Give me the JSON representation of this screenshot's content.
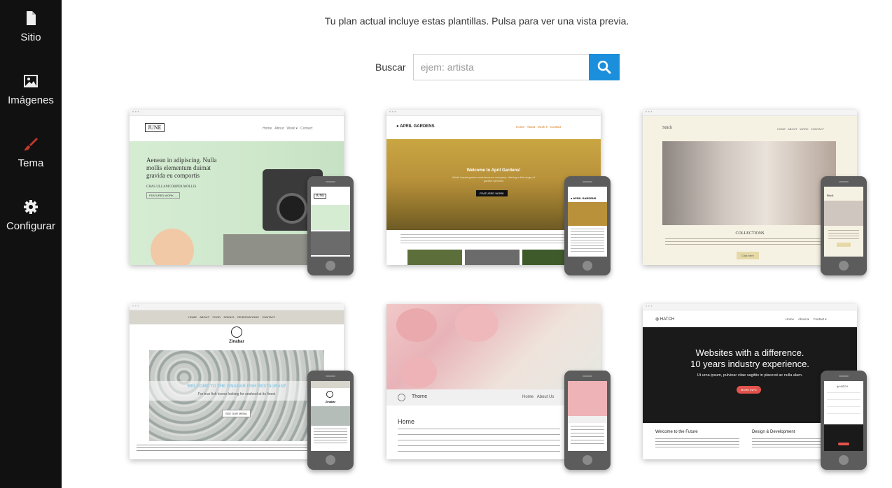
{
  "sidebar": {
    "items": [
      {
        "label": "Sitio",
        "icon": "file-icon"
      },
      {
        "label": "Imágenes",
        "icon": "image-icon"
      },
      {
        "label": "Tema",
        "icon": "brush-icon"
      },
      {
        "label": "Configurar",
        "icon": "gear-icon"
      }
    ]
  },
  "intro": "Tu plan actual incluye estas plantillas. Pulsa para ver una vista previa.",
  "search": {
    "label": "Buscar",
    "placeholder": "ejem: artista",
    "button_icon": "search-icon"
  },
  "colors": {
    "sidebar_bg": "#111111",
    "accent": "#1c8fdc",
    "tema_icon": "#c0392b"
  },
  "templates": [
    {
      "logo": "JUNE",
      "nav": [
        "Home",
        "About",
        "Work ▾",
        "Contact"
      ],
      "heading": "Aenean in adipiscing. Nulla mollis elementum duimat gravida eu comportis",
      "sub": "CRAS ULLAMCORPER MOLLIS",
      "cta": "FEATURED WORK →"
    },
    {
      "logo": "APRIL GARDENS",
      "nav": [
        "Home",
        "About",
        "Work ▾",
        "Contact"
      ],
      "heading": "Welcome to April Gardens!",
      "sub": "Brisbi based garden maintenance company, offering a full range of garden services",
      "cta": "FEATURED WORK"
    },
    {
      "logo": "Stitch",
      "nav": [
        "HOME",
        "ABOUT",
        "WORK",
        "CONTACT"
      ],
      "heading": "COLLECTIONS",
      "cta": "Click here"
    },
    {
      "logo": "Zinabar",
      "nav": [
        "HOME",
        "ABOUT",
        "FOOD",
        "DRINKS",
        "RESERVATIONS",
        "CONTACT"
      ],
      "heading": "WELCOME TO THE ZINABAR FISH RESTAURANT",
      "sub": "For true fish lovers looking for seafood at its finest",
      "cta": "SEE OUR MENU"
    },
    {
      "logo": "Thorne",
      "nav": [
        "Home",
        "About Us"
      ],
      "heading": "Home"
    },
    {
      "logo": "HATCH",
      "nav": [
        "Home",
        "About ▾",
        "Contact ▾"
      ],
      "heading": "Websites with a difference.",
      "heading2": "10 years industry experience.",
      "sub": "Ut urna ipsum, pulvinar vitae sagittis in placerat ac nulla alam.",
      "cta": "MORE INFO",
      "col1": "Welcome to the Future",
      "col2": "Design & Development"
    }
  ]
}
